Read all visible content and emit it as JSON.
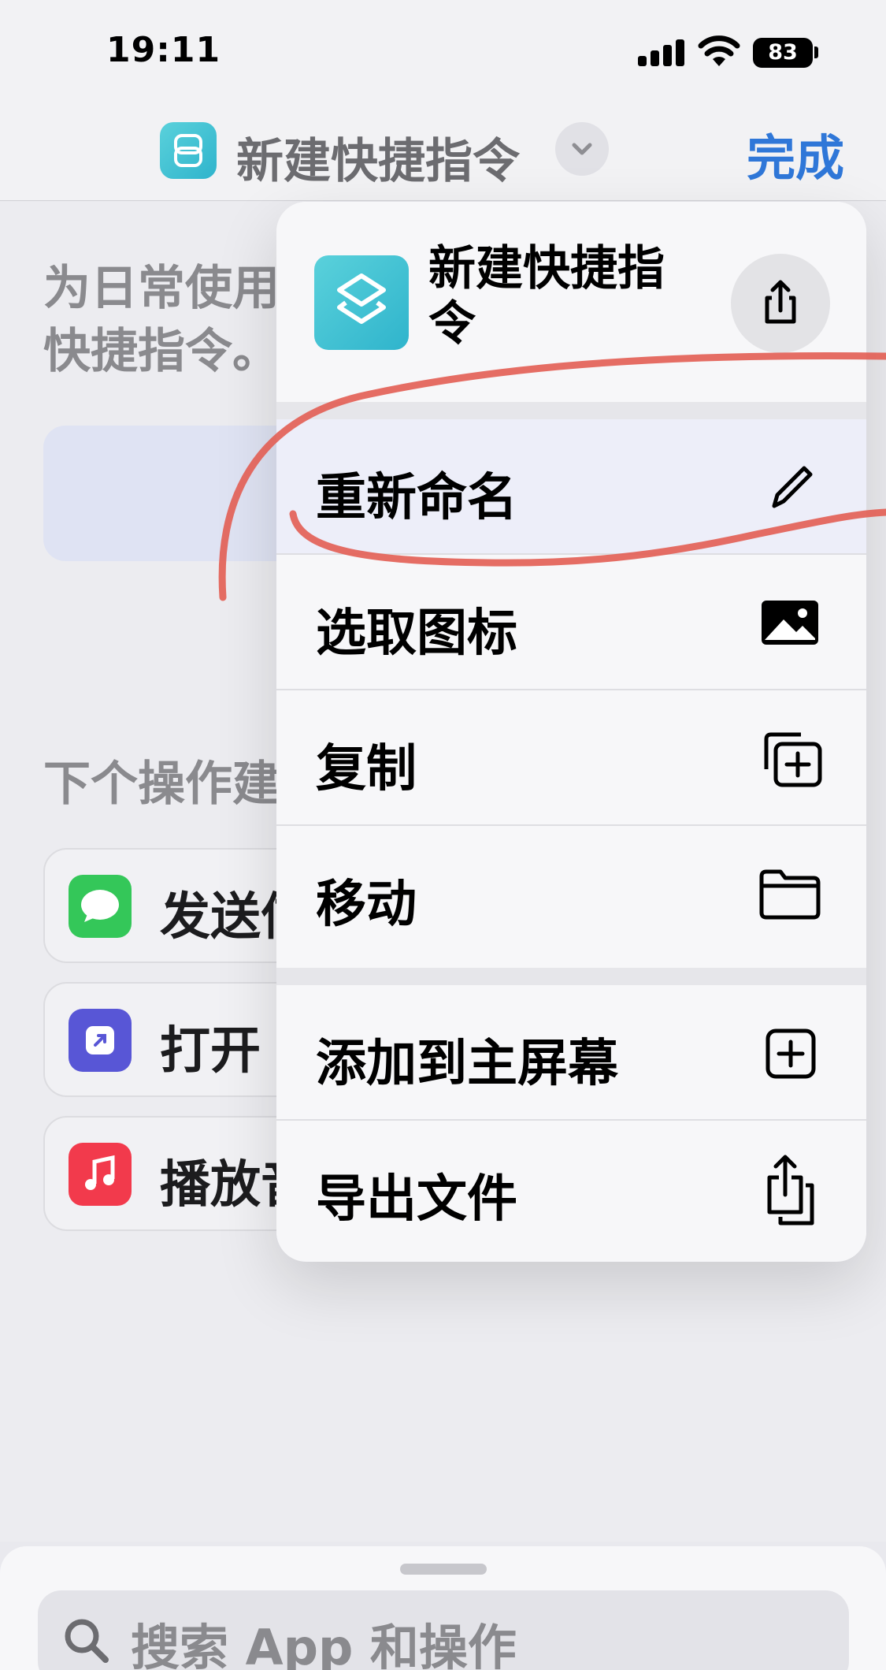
{
  "status_bar": {
    "time": "19:11",
    "battery": "83"
  },
  "nav": {
    "title": "新建快捷指令",
    "done_label": "完成"
  },
  "background": {
    "description_line1": "为日常使用",
    "description_line2": "快捷指令。",
    "next_action_label": "下个操作建议",
    "suggestions": [
      {
        "label": "发送信息",
        "icon": "messages-icon",
        "color": "#34c759"
      },
      {
        "label": "打开 App",
        "icon": "open-app-icon",
        "color": "#5856d6"
      },
      {
        "label": "播放音乐",
        "icon": "music-icon",
        "color": "#ff3b30"
      }
    ]
  },
  "menu": {
    "header_title": "新建快捷指令",
    "items": [
      {
        "label": "重新命名",
        "icon": "pencil-icon"
      },
      {
        "label": "选取图标",
        "icon": "photo-icon"
      },
      {
        "label": "复制",
        "icon": "duplicate-icon"
      },
      {
        "label": "移动",
        "icon": "folder-icon"
      },
      {
        "label": "添加到主屏幕",
        "icon": "add-to-home-icon"
      },
      {
        "label": "导出文件",
        "icon": "export-icon"
      }
    ]
  },
  "search": {
    "placeholder": "搜索 App 和操作"
  },
  "colors": {
    "accent": "#2f77d8",
    "annotation": "#e25a4e",
    "app_icon": "#3fc2d3"
  }
}
